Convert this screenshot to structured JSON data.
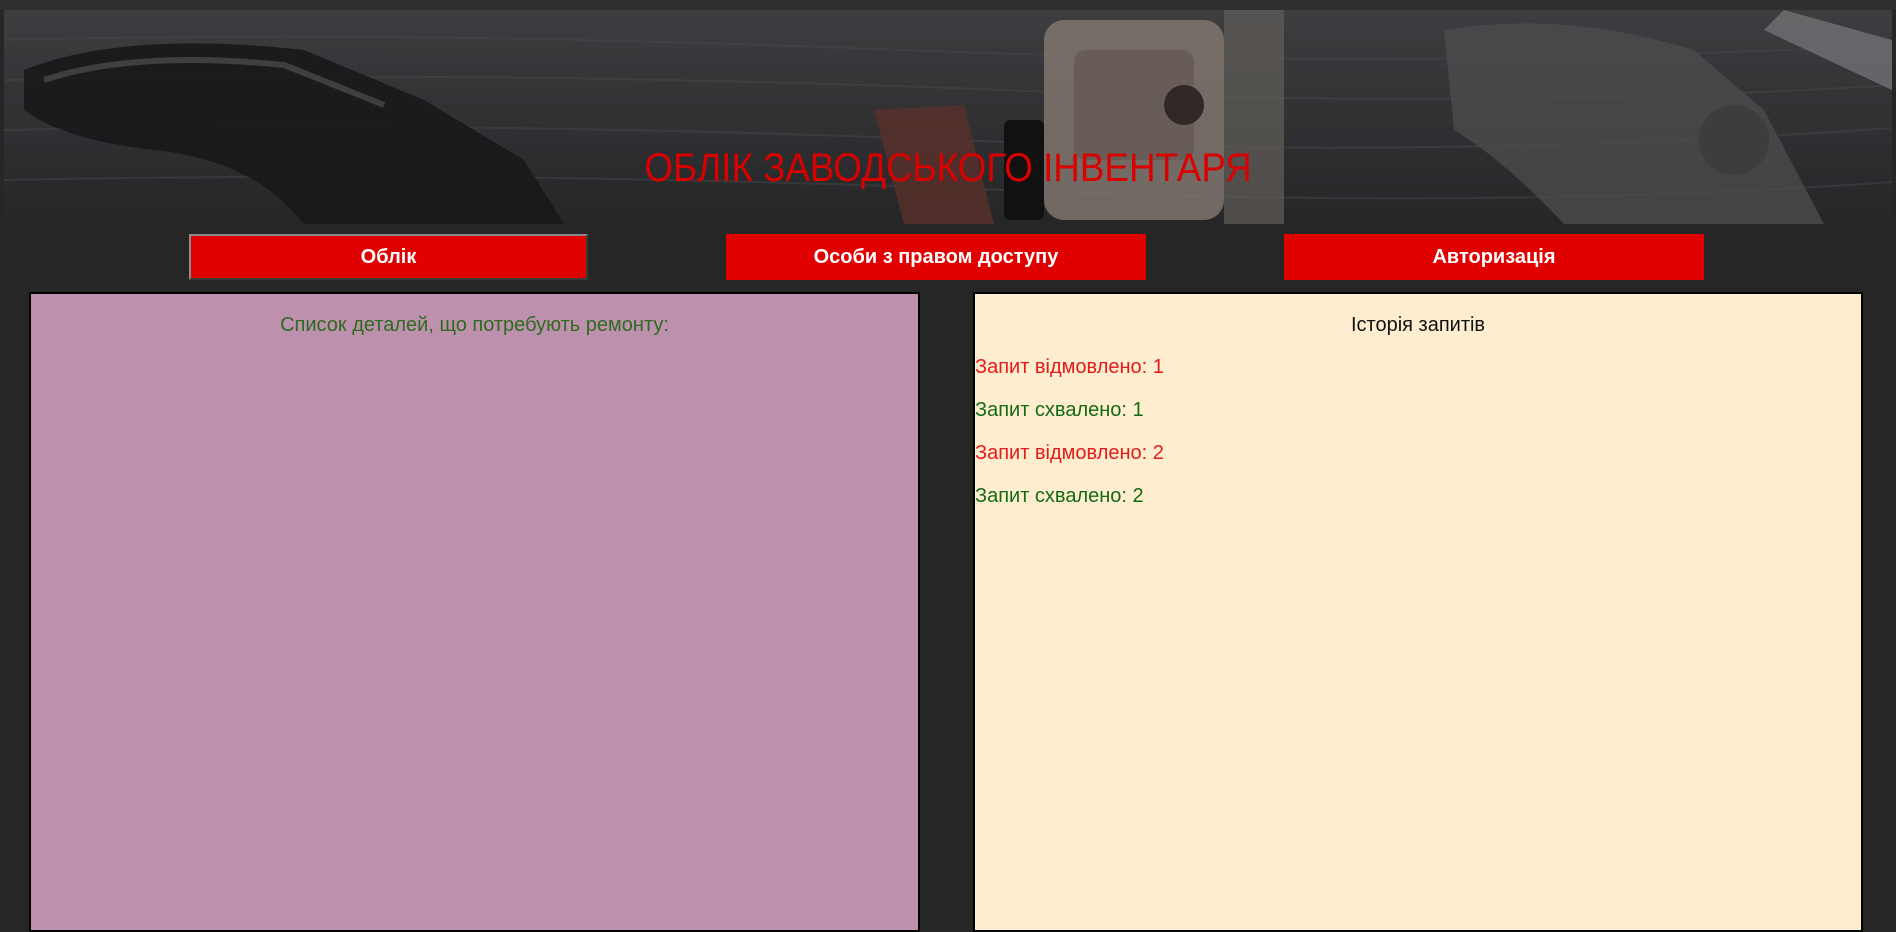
{
  "header": {
    "title": "ОБЛІК ЗАВОДСЬКОГО ІНВЕНТАРЯ"
  },
  "nav": {
    "items": [
      {
        "label": "Облік"
      },
      {
        "label": "Особи з правом доступу"
      },
      {
        "label": "Авторизація"
      }
    ]
  },
  "repair_panel": {
    "title": "Список деталей, що потребують ремонту:"
  },
  "history_panel": {
    "title": "Історія запитів",
    "items": [
      {
        "text": "Запит відмовлено: 1",
        "status": "rejected"
      },
      {
        "text": "Запит схвалено: 1",
        "status": "approved"
      },
      {
        "text": "Запит відмовлено: 2",
        "status": "rejected"
      },
      {
        "text": "Запит схвалено: 2",
        "status": "approved"
      }
    ]
  },
  "colors": {
    "background": "#262626",
    "accent": "#e00000",
    "title_red": "#d90000",
    "repair_panel_bg": "#bd91ad",
    "history_panel_bg": "#ffedcf",
    "rejected": "#e31b1b",
    "approved": "#136b13"
  }
}
